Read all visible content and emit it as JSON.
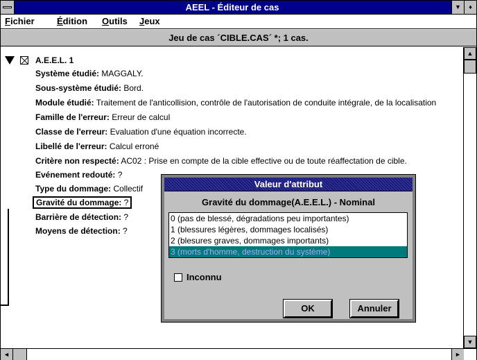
{
  "window": {
    "title": "AEEL - Éditeur de cas",
    "min_icon": "▼",
    "max_icon": "♦"
  },
  "menubar": {
    "items": [
      {
        "mnemonic": "F",
        "rest": "ichier"
      },
      {
        "mnemonic": "É",
        "rest": "dition"
      },
      {
        "mnemonic": "O",
        "rest": "utils"
      },
      {
        "mnemonic": "J",
        "rest": "eux"
      }
    ]
  },
  "caption": "Jeu de cas ´CIBLE.CAS´ *; 1 cas.",
  "tree": {
    "root_label": "A.E.E.L. 1",
    "attributes": [
      {
        "label": "Système étudié:",
        "value": " MAGGALY."
      },
      {
        "label": "Sous-système étudié:",
        "value": " Bord."
      },
      {
        "label": "Module étudié:",
        "value": " Traitement de l'anticollision, contrôle de l'autorisation de conduite intégrale, de la localisation"
      },
      {
        "label": "Famille de l'erreur:",
        "value": " Erreur de calcul"
      },
      {
        "label": "Classe de l'erreur:",
        "value": " Evaluation d'une équation incorrecte."
      },
      {
        "label": "Libellé de l'erreur:",
        "value": " Calcul erroné"
      },
      {
        "label": "Critère non respecté:",
        "value": " AC02 : Prise en compte de la cible effective ou de toute réaffectation de cible."
      },
      {
        "label": "Evénement redouté:",
        "value": " ?"
      },
      {
        "label": "Type du dommage:",
        "value": " Collectif"
      },
      {
        "label": "Gravité du dommage:",
        "value": " ?"
      },
      {
        "label": "Barrière de détection:",
        "value": " ?"
      },
      {
        "label": "Moyens de détection:",
        "value": " ?"
      }
    ]
  },
  "dialog": {
    "title": "Valeur d'attribut",
    "heading": "Gravité du dommage(A.E.E.L.) - Nominal",
    "options": [
      "0 (pas de blessé, dégradations peu importantes)",
      "1 (blessures légères, dommages localisés)",
      "2 (blesures graves, dommages importants)",
      "3 (morts d'homme, destruction du système)"
    ],
    "selected_option": 3,
    "unknown_label": "Inconnu",
    "unknown_checked": false,
    "ok_label": "OK",
    "cancel_label": "Annuler"
  },
  "scroll": {
    "up_icon": "▲",
    "down_icon": "▼",
    "left_icon": "◄",
    "right_icon": "►"
  },
  "colors": {
    "titlebar": "#00008b",
    "selection": "#007a7a",
    "chrome": "#c0c0c0"
  }
}
